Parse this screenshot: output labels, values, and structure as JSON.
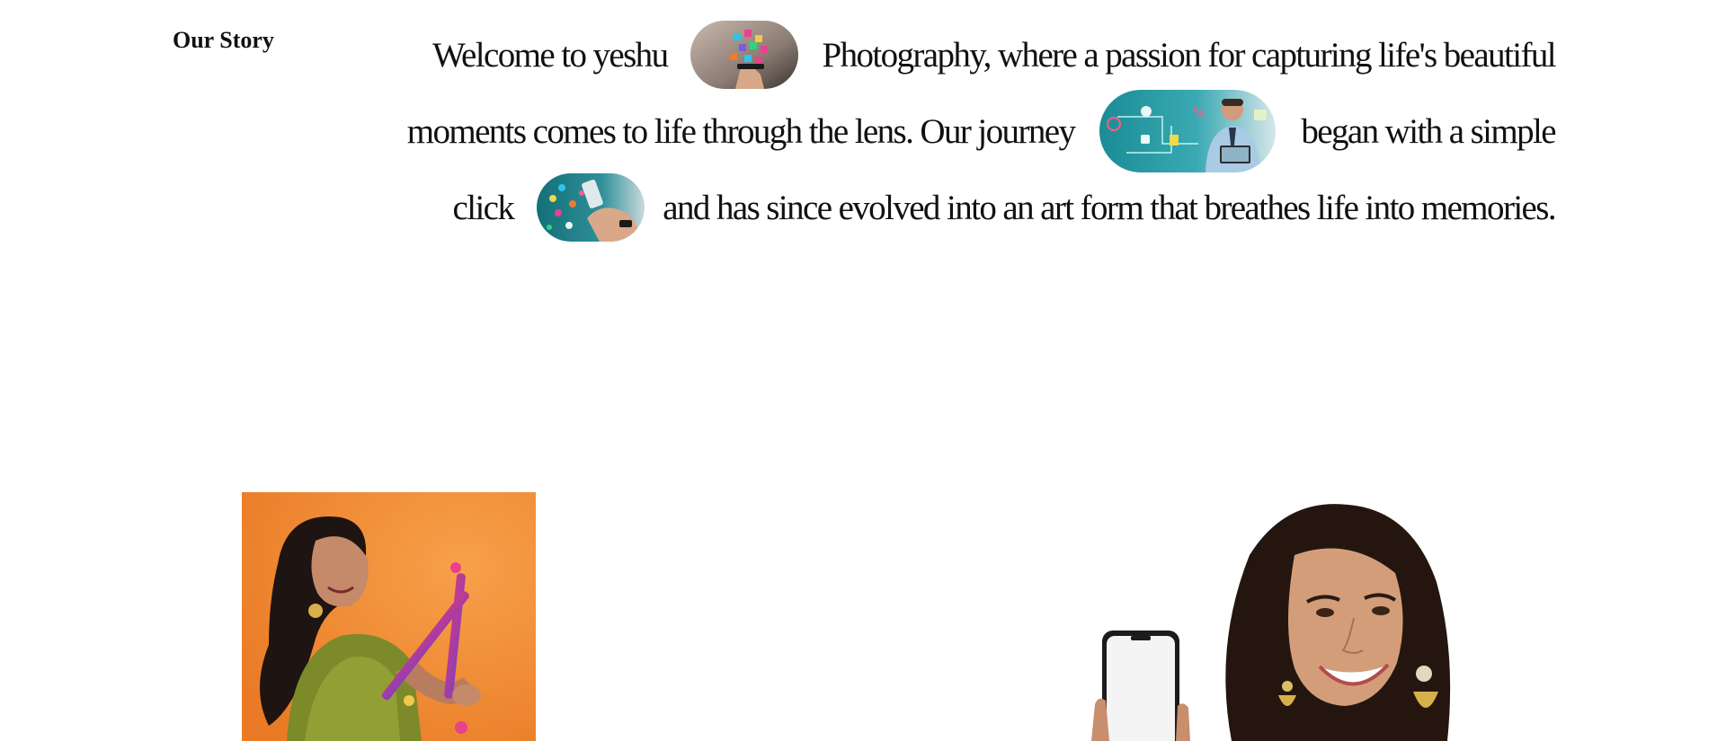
{
  "section": {
    "label": "Our Story"
  },
  "story": {
    "line1_a": "Welcome to yeshu",
    "line1_b": "Photography, where a passion for capturing life's beautiful",
    "line2_a": "moments comes to life through the lens. Our journey",
    "line2_b": "began with a simple",
    "line3_a": "click",
    "line3_b": "and has since evolved into an art form that breathes life into memories."
  },
  "colors": {
    "text": "#111111",
    "background": "#ffffff",
    "left_photo_bg": "#f08a2e",
    "pill_tint": "#1f6f7a"
  }
}
